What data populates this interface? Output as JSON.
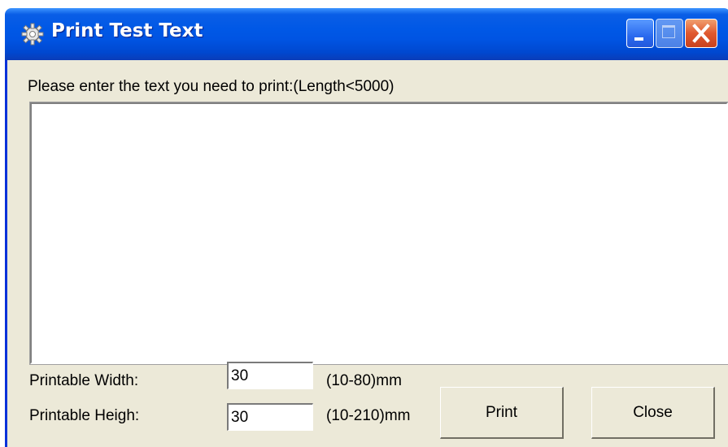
{
  "window": {
    "title": "Print Test Text",
    "title_icon": "gear-icon",
    "controls": [
      "minimize-icon",
      "maximize-icon",
      "close-icon"
    ],
    "titlebar_color": "#0054e3",
    "close_color": "#e0582e",
    "background": "#ece9d8"
  },
  "content": {
    "prompt_label": "Please enter the text you need to print:(Length<5000)",
    "text_value": ""
  },
  "width_row": {
    "label": "Printable Width:",
    "value": "30",
    "range": "(10-80)mm"
  },
  "height_row": {
    "label": "Printable Heigh:",
    "value": "30",
    "range": "(10-210)mm"
  },
  "buttons": {
    "print": "Print",
    "close": "Close"
  }
}
